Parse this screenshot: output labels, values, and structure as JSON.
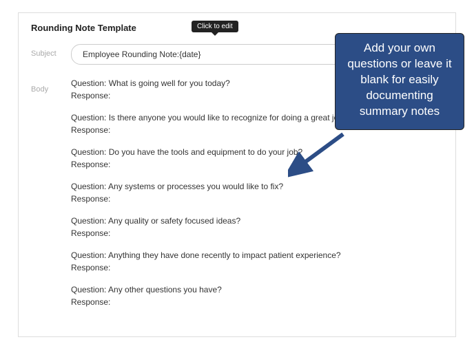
{
  "panel": {
    "title": "Rounding Note Template"
  },
  "tooltip": {
    "text": "Click to edit"
  },
  "subject": {
    "label": "Subject",
    "value": "Employee Rounding Note:{date}"
  },
  "body": {
    "label": "Body",
    "responseLabel": "Response:",
    "questions": [
      "Question: What is going well for you today?",
      "Question: Is there anyone you would like to recognize for doing a great job?",
      "Question: Do you have the tools and equipment to do your job?",
      "Question: Any systems or processes you would like to fix?",
      "Question: Any quality or safety focused ideas?",
      "Question: Anything they have done recently to impact patient experience?",
      "Question: Any other questions you have?"
    ]
  },
  "callout": {
    "text": "Add your own questions or leave it blank for easily documenting summary notes"
  }
}
